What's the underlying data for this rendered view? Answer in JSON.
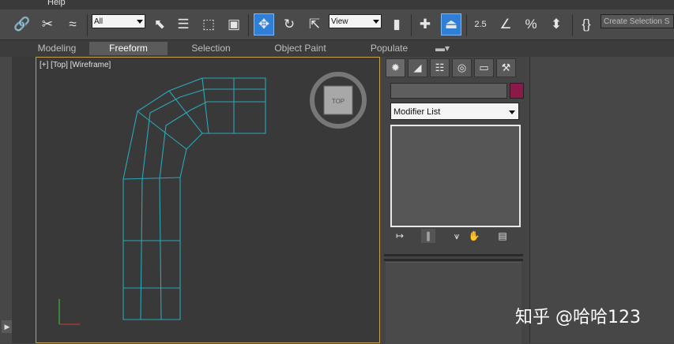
{
  "menu": {
    "help_label": "Help"
  },
  "toolbar": {
    "selection_filter": "All",
    "reference_coord": "View",
    "snap_value": "2.5",
    "selection_set_placeholder": "Create Selection S"
  },
  "ribbon": {
    "tabs": [
      {
        "label": "Modeling",
        "active": false
      },
      {
        "label": "Freeform",
        "active": true
      },
      {
        "label": "Selection",
        "active": false
      },
      {
        "label": "Object Paint",
        "active": false
      },
      {
        "label": "Populate",
        "active": false
      }
    ]
  },
  "viewport": {
    "label": "[+] [Top] [Wireframe]",
    "viewcube_label": "TOP",
    "wire_color": "#2aa8b8"
  },
  "command_panel": {
    "modifier_list": "Modifier List",
    "object_color": "#8a1a4a"
  },
  "watermark": "知乎 @哈哈123"
}
